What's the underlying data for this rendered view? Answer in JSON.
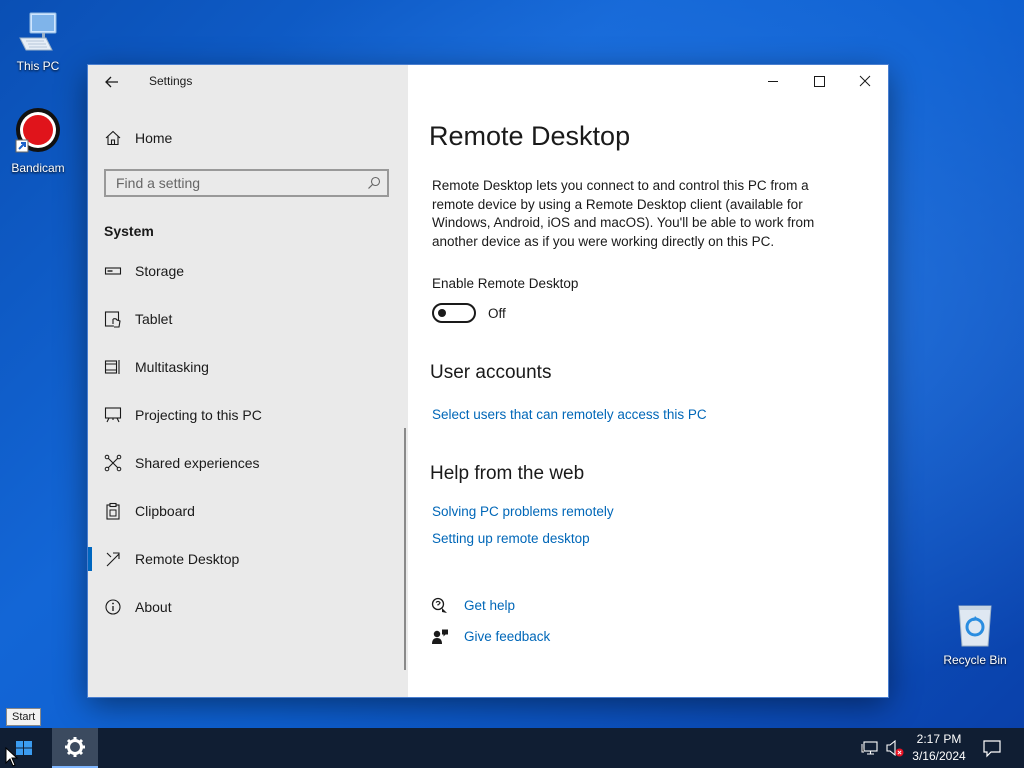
{
  "desktop": {
    "icons": [
      {
        "label": "This PC"
      },
      {
        "label": "Bandicam"
      },
      {
        "label": "Recycle Bin"
      }
    ]
  },
  "window": {
    "title": "Settings",
    "controls": {
      "minimize": "minimize-icon",
      "maximize": "maximize-icon",
      "close": "close-icon"
    }
  },
  "sidebar": {
    "home_label": "Home",
    "search_placeholder": "Find a setting",
    "section_title": "System",
    "items": [
      {
        "label": "Storage",
        "icon": "storage-icon"
      },
      {
        "label": "Tablet",
        "icon": "tablet-icon"
      },
      {
        "label": "Multitasking",
        "icon": "multitasking-icon"
      },
      {
        "label": "Projecting to this PC",
        "icon": "projecting-icon"
      },
      {
        "label": "Shared experiences",
        "icon": "shared-experiences-icon"
      },
      {
        "label": "Clipboard",
        "icon": "clipboard-icon"
      },
      {
        "label": "Remote Desktop",
        "icon": "remote-desktop-icon",
        "selected": true
      },
      {
        "label": "About",
        "icon": "info-icon"
      }
    ]
  },
  "main": {
    "title": "Remote Desktop",
    "description": "Remote Desktop lets you connect to and control this PC from a remote device by using a Remote Desktop client (available for Windows, Android, iOS and macOS). You'll be able to work from another device as if you were working directly on this PC.",
    "enable_label": "Enable Remote Desktop",
    "toggle_state": "Off",
    "user_accounts_heading": "User accounts",
    "user_accounts_link": "Select users that can remotely access this PC",
    "help_heading": "Help from the web",
    "help_links": [
      "Solving PC problems remotely",
      "Setting up remote desktop"
    ],
    "get_help": "Get help",
    "give_feedback": "Give feedback"
  },
  "taskbar": {
    "start_tooltip": "Start",
    "time": "2:17 PM",
    "date": "3/16/2024"
  },
  "colors": {
    "accent": "#0067c0",
    "link": "#0067b8",
    "taskbar": "#101e33"
  }
}
